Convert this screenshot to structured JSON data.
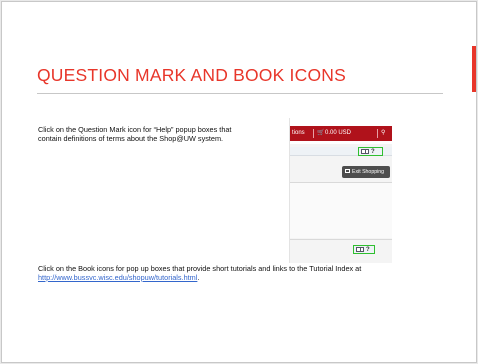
{
  "slide": {
    "title": "QUESTION MARK AND BOOK ICONS",
    "title_color": "#e8362a",
    "accent_color": "#e8362a",
    "paragraph1": "Click on the Question Mark icon for “Help” popup boxes that contain definitions of terms about the Shop@UW system.",
    "paragraph2_prefix": "Click on the Book icons for pop up boxes that provide short tutorials and links to the Tutorial Index at ",
    "paragraph2_link": "http://www.bussvc.wisc.edu/shopuw/tutorials.html",
    "paragraph2_suffix": "."
  },
  "screenshot": {
    "header_ops": "tions",
    "cart_icon": "cart-icon",
    "cart_amount": "0.00 USD",
    "search_icon": "search-icon",
    "help_q": "?",
    "exit_label": "Exit Shopping",
    "help_q2": "?",
    "brand_red": "#b0121b",
    "highlight_green": "#2fbf2f"
  }
}
